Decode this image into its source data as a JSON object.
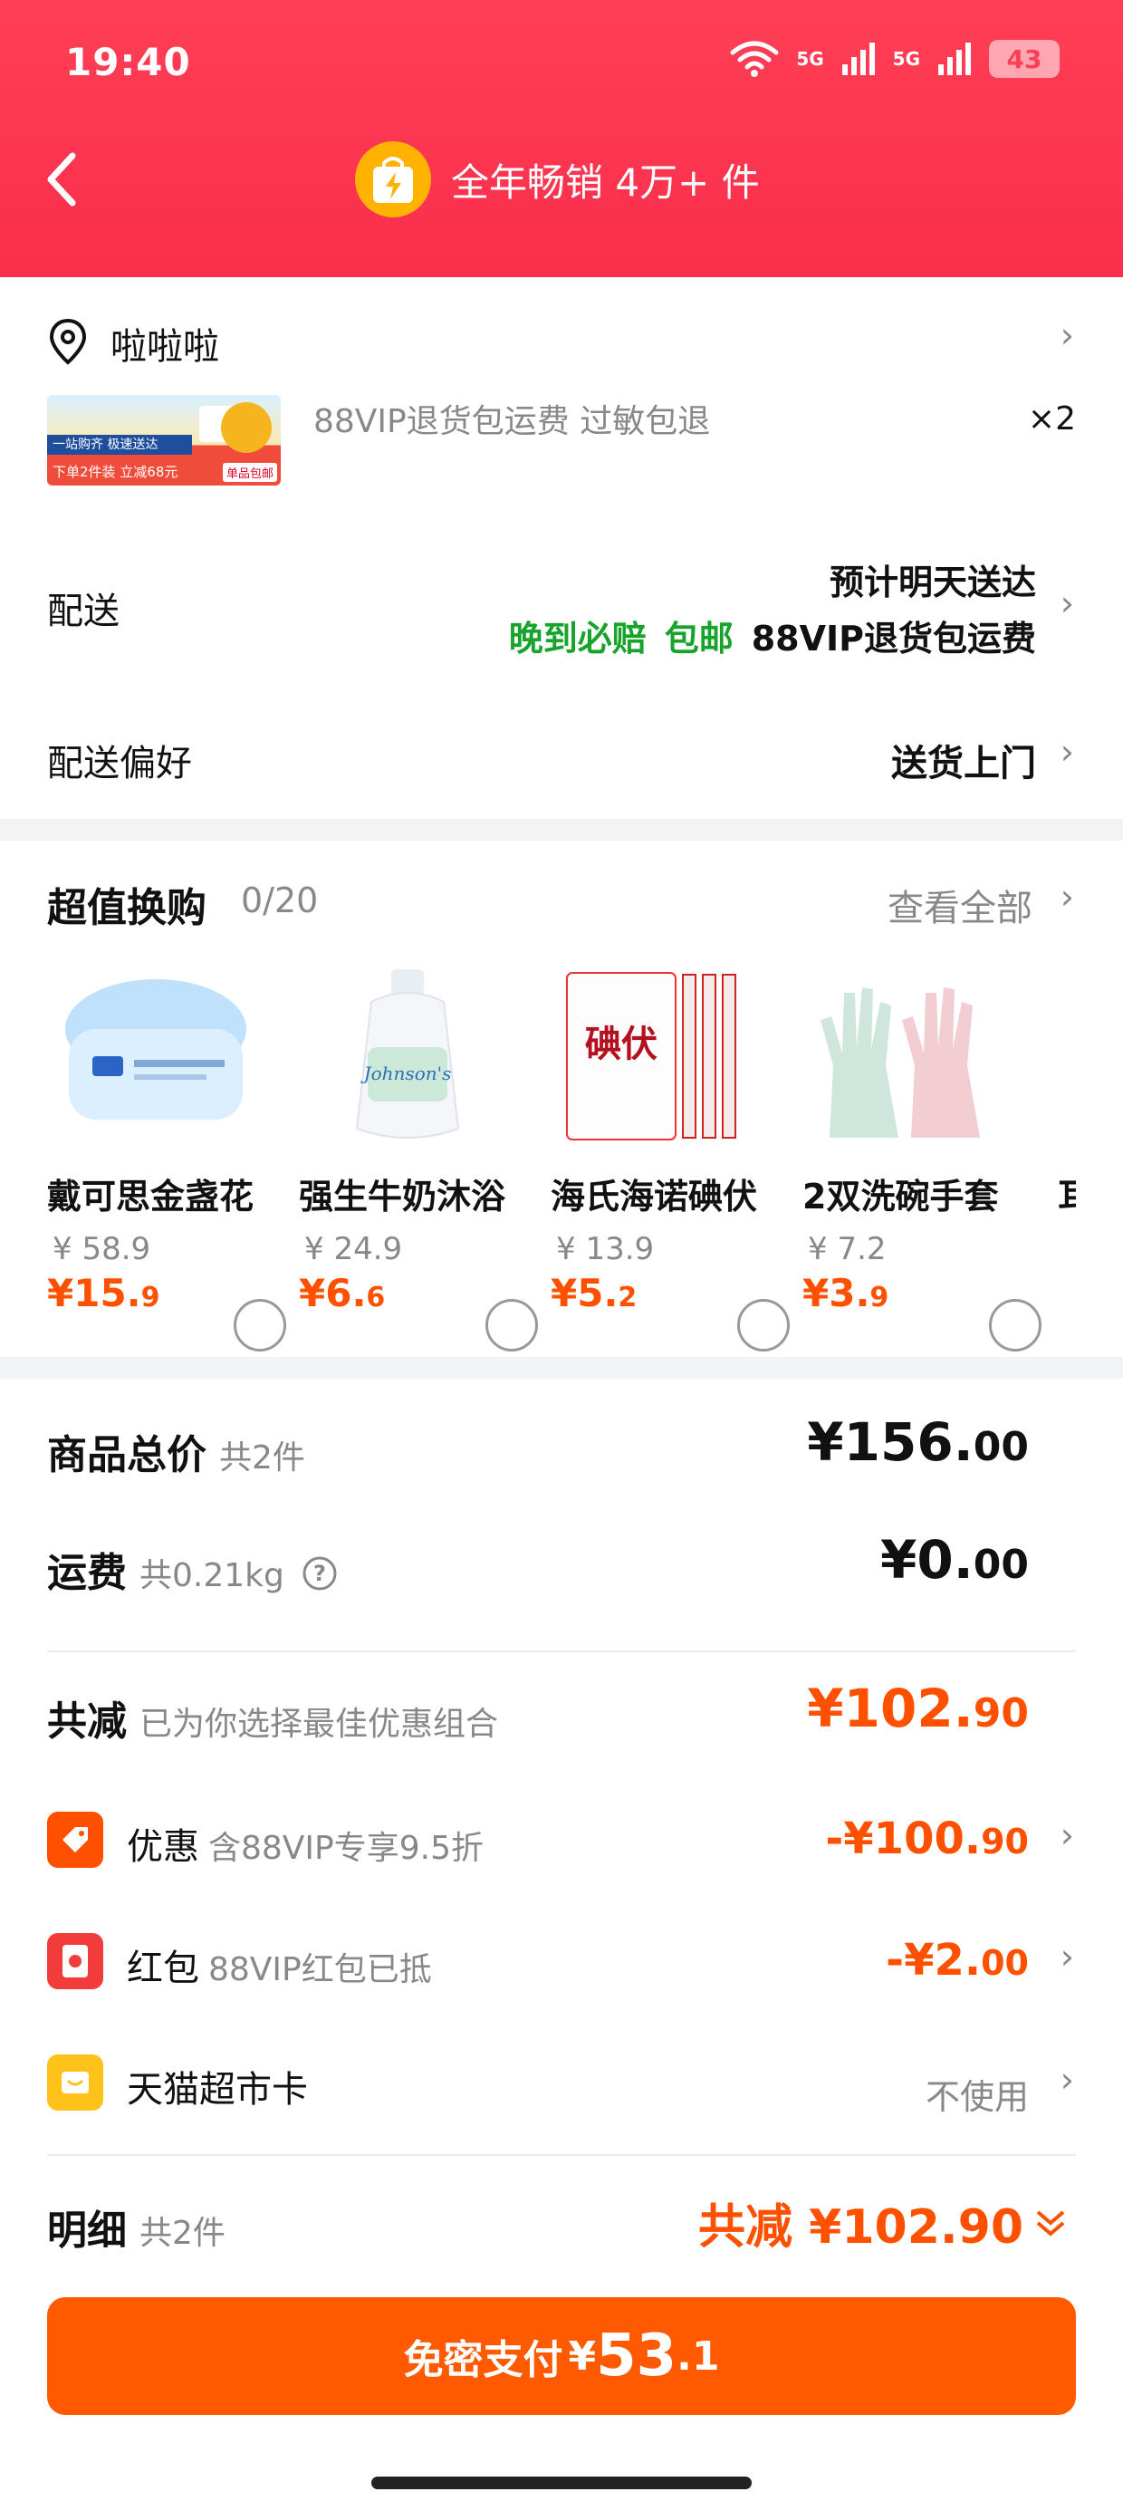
{
  "status_bar": {
    "time": "19:40",
    "net1": "5G",
    "net2": "5G",
    "battery": "43"
  },
  "header": {
    "title": "全年畅销 4万+ 件"
  },
  "address": {
    "name": "啦啦啦"
  },
  "product": {
    "services": "88VIP退货包运费  过敏包退",
    "quantity": "×2",
    "thumb_banner": "一站购齐 极速送达",
    "thumb_strip": "下单2件装 立减68元",
    "thumb_tag": "单品包邮"
  },
  "delivery": {
    "label": "配送",
    "eta": "预计明天送达",
    "tag_late": "晚到必赔",
    "tag_free": "包邮",
    "tag_vip": "88VIP退货包运费"
  },
  "preference": {
    "label": "配送偏好",
    "value": "送货上门"
  },
  "upsell": {
    "title": "超值换购",
    "count": "0/20",
    "see_all": "查看全部",
    "items": [
      {
        "name": "戴可思金盏花",
        "old_price": "¥ 58.9",
        "price_int": "¥15.",
        "price_dec": "9"
      },
      {
        "name": "强生牛奶沐浴",
        "old_price": "¥ 24.9",
        "price_int": "¥6.",
        "price_dec": "6"
      },
      {
        "name": "海氏海诺碘伏",
        "old_price": "¥ 13.9",
        "price_int": "¥5.",
        "price_dec": "2"
      },
      {
        "name": "2双洗碗手套",
        "old_price": "¥ 7.2",
        "price_int": "¥3.",
        "price_dec": "9"
      }
    ],
    "product_labels": {
      "p3_logo": "碘伏",
      "p2_brand": "Johnson's"
    }
  },
  "summary": {
    "total_label": "商品总价",
    "total_sub": "共2件",
    "total_int": "¥156.",
    "total_dec": "00",
    "shipping_label": "运费",
    "shipping_sub": "共0.21kg",
    "shipping_int": "¥0.",
    "shipping_dec": "00",
    "saved_label": "共减",
    "saved_sub": "已为你选择最佳优惠组合",
    "saved_int": "¥102.",
    "saved_dec": "90"
  },
  "discounts": {
    "coupon_label": "优惠",
    "coupon_sub": "含88VIP专享9.5折",
    "coupon_int": "-¥100.",
    "coupon_dec": "90",
    "redpacket_label": "红包",
    "redpacket_sub": "88VIP红包已抵",
    "redpacket_int": "-¥2.",
    "redpacket_dec": "00",
    "card_label": "天猫超市卡",
    "card_value": "不使用"
  },
  "detail": {
    "label": "明细",
    "sub": "共2件",
    "saved": "共减 ¥102.90"
  },
  "pay": {
    "label": "免密支付",
    "yen": "¥",
    "amount": "53",
    "decimal": ".1"
  },
  "colors": {
    "header": "#ff3f56",
    "accent": "#ff5000",
    "green": "#17a32c"
  }
}
